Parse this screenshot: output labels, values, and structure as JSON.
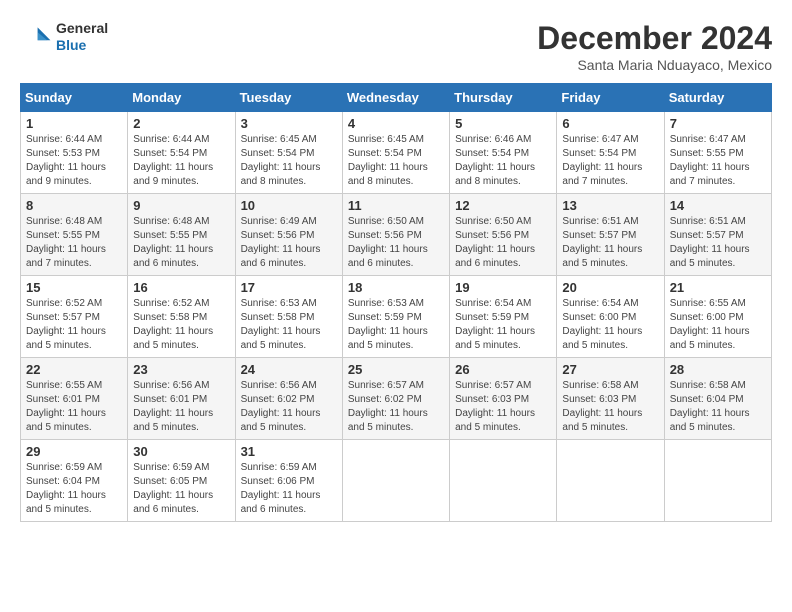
{
  "logo": {
    "line1": "General",
    "line2": "Blue"
  },
  "title": "December 2024",
  "location": "Santa Maria Nduayaco, Mexico",
  "days_of_week": [
    "Sunday",
    "Monday",
    "Tuesday",
    "Wednesday",
    "Thursday",
    "Friday",
    "Saturday"
  ],
  "weeks": [
    [
      {
        "day": "1",
        "sunrise": "6:44 AM",
        "sunset": "5:53 PM",
        "daylight": "11 hours and 9 minutes."
      },
      {
        "day": "2",
        "sunrise": "6:44 AM",
        "sunset": "5:54 PM",
        "daylight": "11 hours and 9 minutes."
      },
      {
        "day": "3",
        "sunrise": "6:45 AM",
        "sunset": "5:54 PM",
        "daylight": "11 hours and 8 minutes."
      },
      {
        "day": "4",
        "sunrise": "6:45 AM",
        "sunset": "5:54 PM",
        "daylight": "11 hours and 8 minutes."
      },
      {
        "day": "5",
        "sunrise": "6:46 AM",
        "sunset": "5:54 PM",
        "daylight": "11 hours and 8 minutes."
      },
      {
        "day": "6",
        "sunrise": "6:47 AM",
        "sunset": "5:54 PM",
        "daylight": "11 hours and 7 minutes."
      },
      {
        "day": "7",
        "sunrise": "6:47 AM",
        "sunset": "5:55 PM",
        "daylight": "11 hours and 7 minutes."
      }
    ],
    [
      {
        "day": "8",
        "sunrise": "6:48 AM",
        "sunset": "5:55 PM",
        "daylight": "11 hours and 7 minutes."
      },
      {
        "day": "9",
        "sunrise": "6:48 AM",
        "sunset": "5:55 PM",
        "daylight": "11 hours and 6 minutes."
      },
      {
        "day": "10",
        "sunrise": "6:49 AM",
        "sunset": "5:56 PM",
        "daylight": "11 hours and 6 minutes."
      },
      {
        "day": "11",
        "sunrise": "6:50 AM",
        "sunset": "5:56 PM",
        "daylight": "11 hours and 6 minutes."
      },
      {
        "day": "12",
        "sunrise": "6:50 AM",
        "sunset": "5:56 PM",
        "daylight": "11 hours and 6 minutes."
      },
      {
        "day": "13",
        "sunrise": "6:51 AM",
        "sunset": "5:57 PM",
        "daylight": "11 hours and 5 minutes."
      },
      {
        "day": "14",
        "sunrise": "6:51 AM",
        "sunset": "5:57 PM",
        "daylight": "11 hours and 5 minutes."
      }
    ],
    [
      {
        "day": "15",
        "sunrise": "6:52 AM",
        "sunset": "5:57 PM",
        "daylight": "11 hours and 5 minutes."
      },
      {
        "day": "16",
        "sunrise": "6:52 AM",
        "sunset": "5:58 PM",
        "daylight": "11 hours and 5 minutes."
      },
      {
        "day": "17",
        "sunrise": "6:53 AM",
        "sunset": "5:58 PM",
        "daylight": "11 hours and 5 minutes."
      },
      {
        "day": "18",
        "sunrise": "6:53 AM",
        "sunset": "5:59 PM",
        "daylight": "11 hours and 5 minutes."
      },
      {
        "day": "19",
        "sunrise": "6:54 AM",
        "sunset": "5:59 PM",
        "daylight": "11 hours and 5 minutes."
      },
      {
        "day": "20",
        "sunrise": "6:54 AM",
        "sunset": "6:00 PM",
        "daylight": "11 hours and 5 minutes."
      },
      {
        "day": "21",
        "sunrise": "6:55 AM",
        "sunset": "6:00 PM",
        "daylight": "11 hours and 5 minutes."
      }
    ],
    [
      {
        "day": "22",
        "sunrise": "6:55 AM",
        "sunset": "6:01 PM",
        "daylight": "11 hours and 5 minutes."
      },
      {
        "day": "23",
        "sunrise": "6:56 AM",
        "sunset": "6:01 PM",
        "daylight": "11 hours and 5 minutes."
      },
      {
        "day": "24",
        "sunrise": "6:56 AM",
        "sunset": "6:02 PM",
        "daylight": "11 hours and 5 minutes."
      },
      {
        "day": "25",
        "sunrise": "6:57 AM",
        "sunset": "6:02 PM",
        "daylight": "11 hours and 5 minutes."
      },
      {
        "day": "26",
        "sunrise": "6:57 AM",
        "sunset": "6:03 PM",
        "daylight": "11 hours and 5 minutes."
      },
      {
        "day": "27",
        "sunrise": "6:58 AM",
        "sunset": "6:03 PM",
        "daylight": "11 hours and 5 minutes."
      },
      {
        "day": "28",
        "sunrise": "6:58 AM",
        "sunset": "6:04 PM",
        "daylight": "11 hours and 5 minutes."
      }
    ],
    [
      {
        "day": "29",
        "sunrise": "6:59 AM",
        "sunset": "6:04 PM",
        "daylight": "11 hours and 5 minutes."
      },
      {
        "day": "30",
        "sunrise": "6:59 AM",
        "sunset": "6:05 PM",
        "daylight": "11 hours and 6 minutes."
      },
      {
        "day": "31",
        "sunrise": "6:59 AM",
        "sunset": "6:06 PM",
        "daylight": "11 hours and 6 minutes."
      },
      null,
      null,
      null,
      null
    ]
  ]
}
